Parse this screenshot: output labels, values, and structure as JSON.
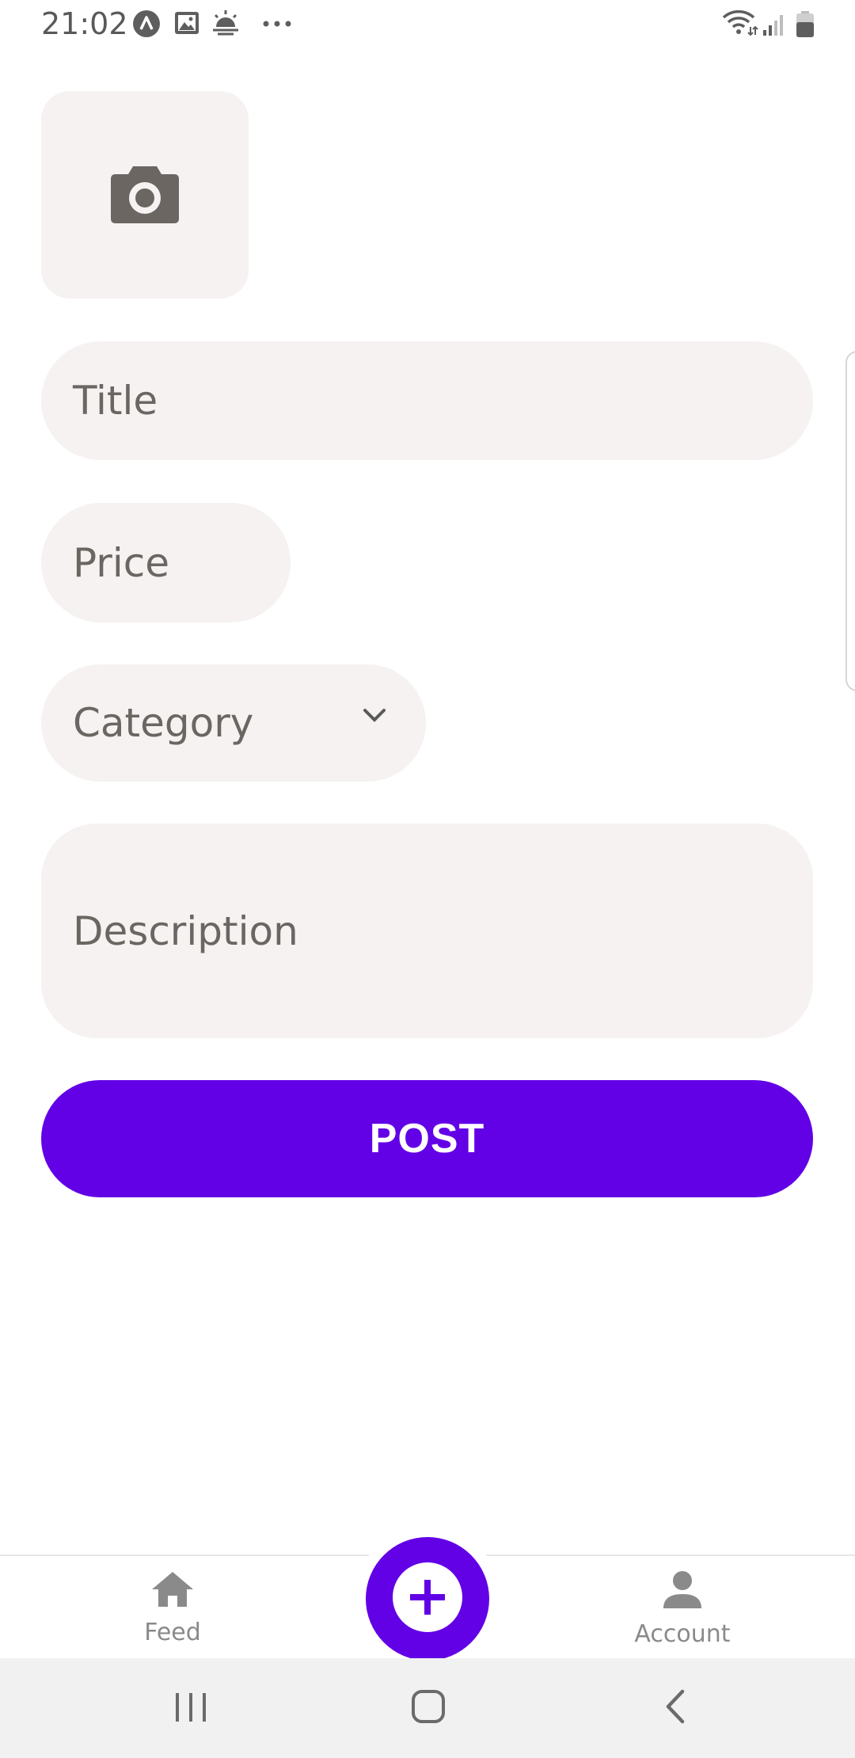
{
  "status_bar": {
    "time": "21:02",
    "icons": [
      "app-notification-icon",
      "image-icon",
      "weather-icon",
      "more-dots-icon",
      "wifi-icon",
      "signal-icon",
      "battery-icon"
    ]
  },
  "form": {
    "photo_picker_icon": "camera-icon",
    "title_placeholder": "Title",
    "price_placeholder": "Price",
    "category_placeholder": "Category",
    "description_placeholder": "Description",
    "post_label": "POST"
  },
  "tab_bar": {
    "feed_label": "Feed",
    "account_label": "Account",
    "center_action_icon": "plus-circle-icon"
  },
  "nav_bar": {
    "buttons": [
      "recents-icon",
      "home-icon",
      "back-icon"
    ]
  },
  "colors": {
    "accent": "#6200e6",
    "field_background": "#f5f2f1",
    "placeholder_text": "#6b6662"
  }
}
